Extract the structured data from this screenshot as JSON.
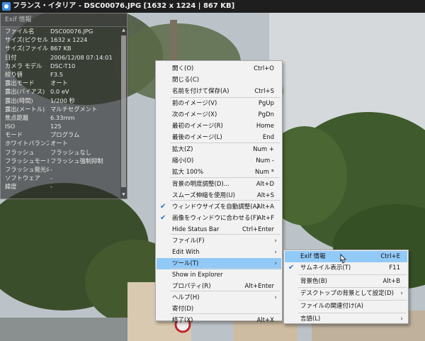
{
  "titlebar": {
    "title": "フランス・イタリア - DSC00076.JPG  [1632 x 1224  |  867 KB]"
  },
  "exif": {
    "header": "Exif 情報",
    "rows": [
      {
        "k": "ファイル名",
        "v": "DSC00076.JPG"
      },
      {
        "k": "サイズ(ピクセル)",
        "v": "1632 x 1224"
      },
      {
        "k": "サイズ(ファイル)",
        "v": "867 KB"
      },
      {
        "k": "日付",
        "v": "2006/12/08 07:14:01"
      },
      {
        "k": "カメラ モデル",
        "v": "DSC-T10"
      },
      {
        "k": "絞り値",
        "v": "F3.5"
      },
      {
        "k": "露出モード",
        "v": "オート"
      },
      {
        "k": "露出(バイアス)",
        "v": "0.0 eV"
      },
      {
        "k": "露出(時間)",
        "v": "1/200 秒"
      },
      {
        "k": "露出(メートル)",
        "v": "マルチセグメント"
      },
      {
        "k": "焦点距離",
        "v": "6.33mm"
      },
      {
        "k": "ISO",
        "v": "125"
      },
      {
        "k": "モード",
        "v": "プログラム"
      },
      {
        "k": "ホワイトバランス",
        "v": "オート"
      },
      {
        "k": "フラッシュ",
        "v": "フラッシュなし"
      },
      {
        "k": "フラッシュモード",
        "v": "フラッシュ強制抑制"
      },
      {
        "k": "フラッシュ発光の...",
        "v": "-"
      },
      {
        "k": "ソフトウェア",
        "v": "-"
      },
      {
        "k": "緯度",
        "v": "-"
      }
    ]
  },
  "menu": {
    "items": [
      {
        "label": "開く(O)",
        "shortcut": "Ctrl+O"
      },
      {
        "label": "閉じる(C)",
        "shortcut": ""
      },
      {
        "label": "名前を付けて保存(A)",
        "shortcut": "Ctrl+S"
      },
      {
        "label": "前のイメージ(V)",
        "shortcut": "PgUp"
      },
      {
        "label": "次のイメージ(X)",
        "shortcut": "PgDn"
      },
      {
        "label": "最初のイメージ(R)",
        "shortcut": "Home"
      },
      {
        "label": "最後のイメージ(L)",
        "shortcut": "End"
      },
      {
        "label": "拡大(Z)",
        "shortcut": "Num +"
      },
      {
        "label": "縮小(O)",
        "shortcut": "Num -"
      },
      {
        "label": "拡大 100%",
        "shortcut": "Num *"
      },
      {
        "label": "背景の明度調整(D)...",
        "shortcut": "Alt+D"
      },
      {
        "label": "スムーズ伸縮を使用(U)",
        "shortcut": "Alt+S"
      },
      {
        "label": "ウィンドウサイズを自動調整(A)",
        "shortcut": "Alt+A",
        "checked": true
      },
      {
        "label": "画像をウィンドウに合わせる(F)",
        "shortcut": "Alt+F",
        "checked": true
      },
      {
        "label": "Hide Status Bar",
        "shortcut": "Ctrl+Enter"
      },
      {
        "label": "ファイル(F)",
        "shortcut": "",
        "submenu": true
      },
      {
        "label": "Edit With",
        "shortcut": "",
        "submenu": true
      },
      {
        "label": "ツール(T)",
        "shortcut": "",
        "submenu": true,
        "highlighted": true
      },
      {
        "label": "Show in Explorer",
        "shortcut": ""
      },
      {
        "label": "プロパティ(R)",
        "shortcut": "Alt+Enter"
      },
      {
        "label": "ヘルプ(H)",
        "shortcut": "",
        "submenu": true
      },
      {
        "label": "寄付(D)",
        "shortcut": ""
      },
      {
        "label": "終了(X)",
        "shortcut": "Alt+X"
      }
    ]
  },
  "submenu": {
    "items": [
      {
        "label": "Exif 情報",
        "shortcut": "Ctrl+E",
        "highlighted": true
      },
      {
        "label": "サムネイル表示(T)",
        "shortcut": "F11",
        "checked": true
      },
      {
        "label": "背景色(B)",
        "shortcut": "Alt+B"
      },
      {
        "label": "デスクトップの背景として設定(D)",
        "shortcut": "",
        "submenu": true
      },
      {
        "label": "ファイルの関連付け(A)",
        "shortcut": ""
      },
      {
        "label": "言語(L)",
        "shortcut": "",
        "submenu": true
      }
    ]
  },
  "colors": {
    "highlight": "#91c9f7",
    "menu_bg": "#f2f2f2",
    "check": "#2a6fcf",
    "titlebar": "#1e1e1e"
  }
}
